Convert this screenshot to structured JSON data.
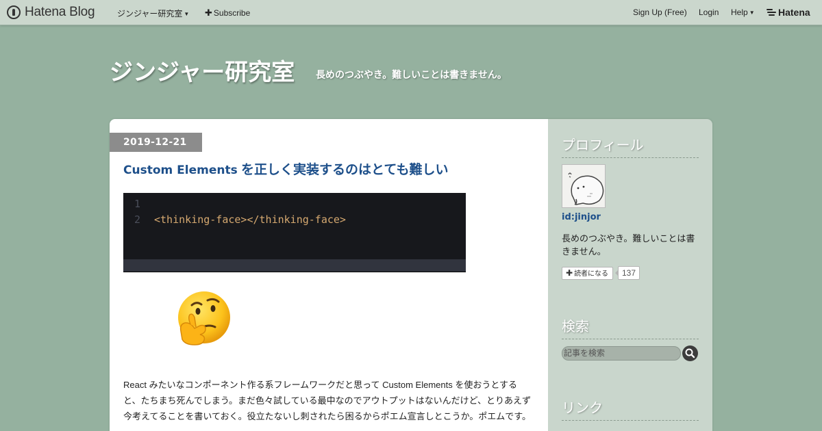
{
  "globalbar": {
    "logo_text": "Hatena Blog",
    "blog_menu_label": "ジンジャー研究室",
    "subscribe_label": "Subscribe",
    "signup_label": "Sign Up (Free)",
    "login_label": "Login",
    "help_label": "Help",
    "hatena_label": "Hatena"
  },
  "blog": {
    "title": "ジンジャー研究室",
    "description": "長めのつぶやき。難しいことは書きません。"
  },
  "entry": {
    "date": "2019-12-21",
    "title_en": "Custom Elements",
    "title_ja": " を正しく実装するのはとても難しい",
    "code": {
      "lines": [
        {
          "number": "1",
          "text": ""
        },
        {
          "number": "2",
          "text": "<thinking-face></thinking-face>"
        }
      ]
    },
    "emoji_name": "thinking-face",
    "body": "React みたいなコンポーネント作る系フレームワークだと思って Custom Elements を使おうとすると、たちまち死んでしまう。まだ色々試している最中なのでアウトプットはないんだけど、とりあえず今考えてることを書いておく。役立たないし刺されたら困るからポエム宣言しとこうか。ポエムです。"
  },
  "sidebar": {
    "profile": {
      "heading": "プロフィール",
      "user_id": "id:jinjor",
      "description": "長めのつぶやき。難しいことは書きません。",
      "subscribe_label": "読者になる",
      "subscriber_count": "137"
    },
    "search": {
      "heading": "検索",
      "placeholder": "記事を検索"
    },
    "links": {
      "heading": "リンク"
    }
  },
  "colors": {
    "background": "#95b19f",
    "topbar": "#cbd7cd",
    "sidebar": "#c9d6cc",
    "entry_title": "#1d4f8a",
    "code_bg": "#17181c",
    "code_text": "#d6a970"
  }
}
